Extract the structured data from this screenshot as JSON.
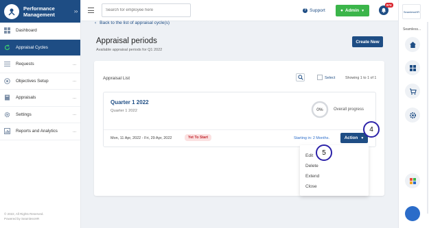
{
  "sidebar": {
    "title": "Performance Management",
    "items": [
      {
        "label": "Dashboard",
        "icon": "grid-icon",
        "active": false,
        "has_more": false
      },
      {
        "label": "Appraisal Cycles",
        "icon": "refresh-icon",
        "active": true,
        "has_more": false
      },
      {
        "label": "Requests",
        "icon": "list-icon",
        "active": false,
        "has_more": true
      },
      {
        "label": "Objectives Setup",
        "icon": "target-icon",
        "active": false,
        "has_more": true
      },
      {
        "label": "Appraisals",
        "icon": "book-icon",
        "active": false,
        "has_more": true
      },
      {
        "label": "Settings",
        "icon": "gear-icon",
        "active": false,
        "has_more": true
      },
      {
        "label": "Reports and Analytics",
        "icon": "chart-icon",
        "active": false,
        "has_more": true
      }
    ],
    "more_label": "...",
    "footer_line1": "© 2022, All Rights Reserved.",
    "footer_line2": "Powered by SeamlessHR"
  },
  "topbar": {
    "search_placeholder": "Search for employee here",
    "support_label": "Support",
    "admin_label": "Admin",
    "notification_count": "674"
  },
  "rail": {
    "logo_text": "SeamlessHR",
    "label": "Seamless..."
  },
  "main": {
    "back_link": "Back to the list of appraisal cycle(s)",
    "title": "Appraisal periods",
    "subtitle": "Available appraisal periods for Q1 2022",
    "create_button": "Create New",
    "card_title": "Appraisal List",
    "select_label": "Select",
    "showing_text": "Showing 1 to 1 of 1",
    "period": {
      "name": "Quarter 1 2022",
      "sub": "Quarter 1 2022",
      "progress": "0%",
      "progress_value": 0,
      "progress_label": "Overall progress",
      "date_range": "Mon, 11 Apr, 2022 - Fri, 29 Apr, 2022",
      "status": "Yet To Start",
      "starting": "Starting in: 2 Months.",
      "action_button": "Action"
    },
    "dropdown": [
      "Edit",
      "Delete",
      "Extend",
      "Close"
    ]
  },
  "callouts": [
    "4",
    "5"
  ],
  "colors": {
    "primary": "#1e4d84",
    "active_nav": "#1e4d84",
    "success": "#3bb54a",
    "danger": "#d9262f",
    "callout_ring": "#2b21a8"
  }
}
